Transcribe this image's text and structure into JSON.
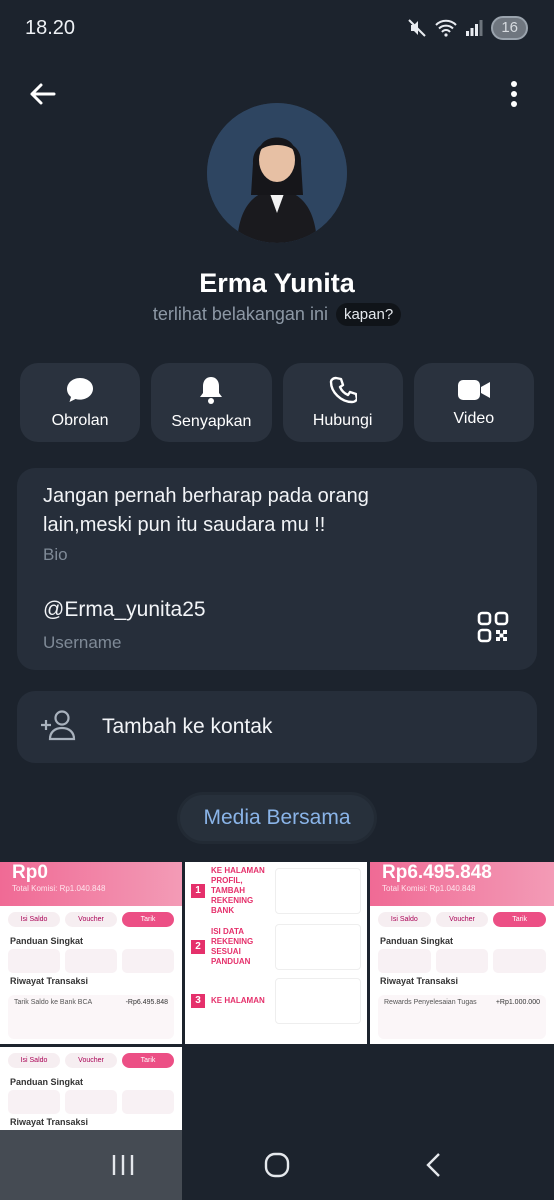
{
  "status": {
    "time": "18.20",
    "battery": "16"
  },
  "profile": {
    "name": "Erma Yunita",
    "last_seen": "terlihat belakangan ini",
    "last_seen_hint": "kapan?"
  },
  "actions": [
    {
      "label": "Obrolan",
      "icon": "chat-bubble-icon"
    },
    {
      "label": "Senyapkan",
      "icon": "bell-icon"
    },
    {
      "label": "Hubungi",
      "icon": "phone-icon"
    },
    {
      "label": "Video",
      "icon": "video-camera-icon"
    }
  ],
  "info": {
    "bio": "Jangan pernah berharap pada orang lain,meski pun itu saudara mu !!",
    "bio_label": "Bio",
    "username": "@Erma_yunita25",
    "username_label": "Username"
  },
  "add_contact": {
    "label": "Tambah ke kontak"
  },
  "media": {
    "tab_label": "Media Bersama",
    "thumbs": {
      "t1": {
        "amount": "Rp0",
        "sub": "Total Komisi: Rp1.040.848",
        "chips": [
          "Isi Saldo",
          "Voucher",
          "Tarik"
        ],
        "guide": "Panduan Singkat",
        "history": "Riwayat Transaksi",
        "row": "Tarik Saldo ke Bank BCA",
        "row_amt": "-Rp6.495.848"
      },
      "t2": {
        "steps": [
          "KE HALAMAN PROFIL, TAMBAH REKENING BANK",
          "ISI DATA REKENING SESUAI PANDUAN",
          "KE HALAMAN"
        ]
      },
      "t3": {
        "amount": "Rp6.495.848",
        "sub": "Total Komisi: Rp1.040.848",
        "chips": [
          "Isi Saldo",
          "Voucher",
          "Tarik"
        ],
        "guide": "Panduan Singkat",
        "history": "Riwayat Transaksi",
        "row": "Rewards Penyelesaian Tugas",
        "row_amt": "+Rp1.000.000"
      },
      "t4": {
        "chips": [
          "Isi Saldo",
          "Voucher",
          "Tarik"
        ],
        "guide": "Panduan Singkat",
        "history": "Riwayat Transaksi"
      }
    }
  },
  "colors": {
    "background": "#1c232d",
    "card": "#262e3a",
    "accent": "#8ab4e8",
    "pink": "#ec4f85"
  }
}
